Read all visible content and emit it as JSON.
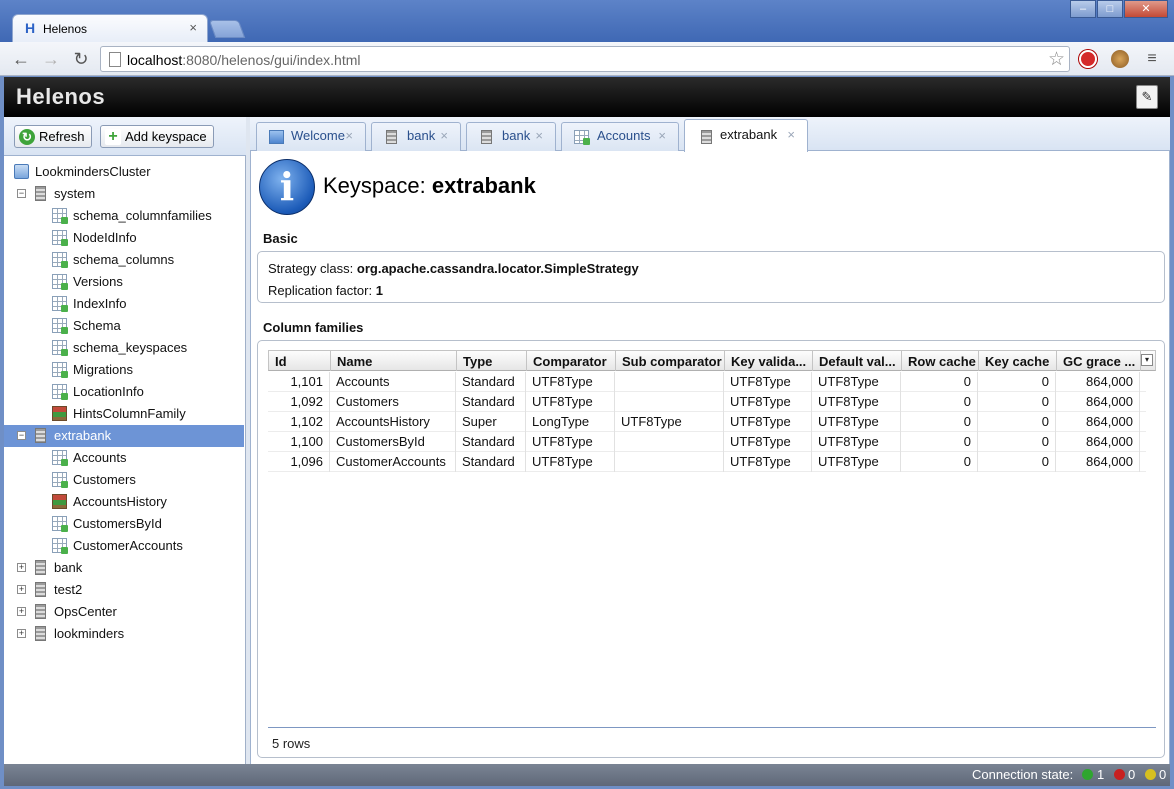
{
  "browser": {
    "tab_title": "Helenos",
    "tab_close": "×",
    "url_host": "localhost",
    "url_path": ":8080/helenos/gui/index.html"
  },
  "app": {
    "brand": "Helenos"
  },
  "left_toolbar": {
    "refresh_label": "Refresh",
    "add_keyspace_label": "Add keyspace"
  },
  "tree": {
    "cluster": "LookmindersCluster",
    "system": {
      "label": "system",
      "children": [
        "schema_columnfamilies",
        "NodeIdInfo",
        "schema_columns",
        "Versions",
        "IndexInfo",
        "Schema",
        "schema_keyspaces",
        "Migrations",
        "LocationInfo",
        "HintsColumnFamily"
      ]
    },
    "extrabank": {
      "label": "extrabank",
      "children": [
        "Accounts",
        "Customers",
        "AccountsHistory",
        "CustomersById",
        "CustomerAccounts"
      ]
    },
    "others": [
      "bank",
      "test2",
      "OpsCenter",
      "lookminders"
    ]
  },
  "tabs": [
    {
      "label": "Welcome",
      "icon": "home-icon"
    },
    {
      "label": "bank",
      "icon": "keyspace-icon"
    },
    {
      "label": "bank",
      "icon": "keyspace-icon"
    },
    {
      "label": "Accounts",
      "icon": "column-family-icon"
    },
    {
      "label": "extrabank",
      "icon": "keyspace-icon"
    }
  ],
  "tab_close": "×",
  "keyspace": {
    "title_prefix": "Keyspace:",
    "name": "extrabank",
    "basic_title": "Basic",
    "strategy_label": "Strategy class:",
    "strategy_value": "org.apache.cassandra.locator.SimpleStrategy",
    "replication_label": "Replication factor:",
    "replication_value": "1",
    "cf_title": "Column families"
  },
  "grid": {
    "columns": [
      "Id",
      "Name",
      "Type",
      "Comparator",
      "Sub comparator",
      "Key valida...",
      "Default val...",
      "Row cache",
      "Key cache",
      "GC grace ..."
    ],
    "rows": [
      [
        "1,101",
        "Accounts",
        "Standard",
        "UTF8Type",
        "",
        "UTF8Type",
        "UTF8Type",
        "0",
        "0",
        "864,000"
      ],
      [
        "1,092",
        "Customers",
        "Standard",
        "UTF8Type",
        "",
        "UTF8Type",
        "UTF8Type",
        "0",
        "0",
        "864,000"
      ],
      [
        "1,102",
        "AccountsHistory",
        "Super",
        "LongType",
        "UTF8Type",
        "UTF8Type",
        "UTF8Type",
        "0",
        "0",
        "864,000"
      ],
      [
        "1,100",
        "CustomersById",
        "Standard",
        "UTF8Type",
        "",
        "UTF8Type",
        "UTF8Type",
        "0",
        "0",
        "864,000"
      ],
      [
        "1,096",
        "CustomerAccounts",
        "Standard",
        "UTF8Type",
        "",
        "UTF8Type",
        "UTF8Type",
        "0",
        "0",
        "864,000"
      ]
    ],
    "footer": "5 rows"
  },
  "status": {
    "label": "Connection state:",
    "green": "1",
    "red": "0",
    "yellow": "0"
  },
  "colors": {
    "selection": "#6d94d6",
    "status_green": "#2fa52f",
    "status_red": "#c82020",
    "status_yellow": "#d6c020"
  }
}
